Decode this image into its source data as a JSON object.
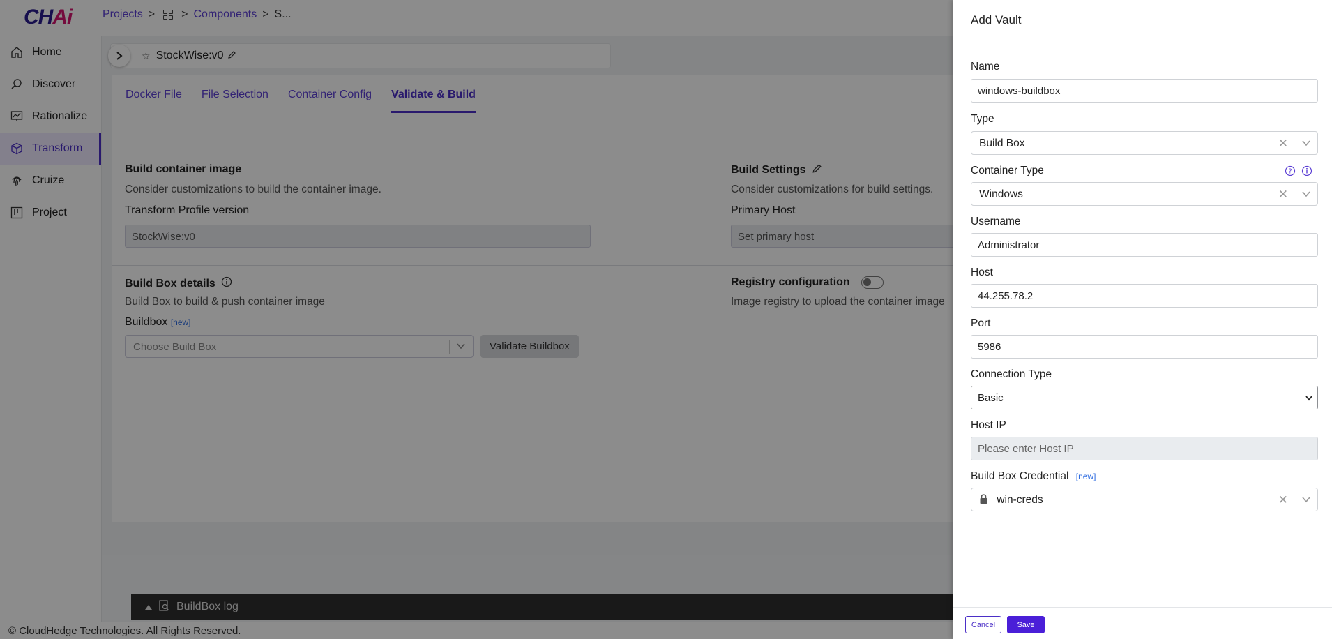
{
  "app": {
    "logo_main": "CH",
    "logo_accent": "Ai",
    "breadcrumb": {
      "projects": "Projects",
      "components": "Components",
      "current": "S..."
    },
    "footer": "© CloudHedge Technologies. All Rights Reserved.",
    "buildbox_log": "BuildBox log"
  },
  "sidebar": {
    "items": [
      {
        "label": "Home",
        "icon": "home-icon"
      },
      {
        "label": "Discover",
        "icon": "search-icon"
      },
      {
        "label": "Rationalize",
        "icon": "chart-icon"
      },
      {
        "label": "Transform",
        "icon": "cube-icon"
      },
      {
        "label": "Cruize",
        "icon": "fingerprint-icon"
      },
      {
        "label": "Project",
        "icon": "board-icon"
      }
    ],
    "active": "Transform"
  },
  "project": {
    "name": "StockWise:v0"
  },
  "tabs": [
    "Docker File",
    "File Selection",
    "Container Config",
    "Validate & Build"
  ],
  "build": {
    "container_title": "Build container image",
    "container_desc": "Consider customizations to build the container image.",
    "profile_label": "Transform Profile version",
    "profile_value": "StockWise:v0",
    "settings_title": "Build Settings",
    "settings_desc": "Consider customizations for build settings.",
    "primary_host_label": "Primary Host",
    "primary_host_placeholder": "Set primary host",
    "buildbox_title": "Build Box details",
    "buildbox_desc": "Build Box to build & push container image",
    "buildbox_label": "Buildbox",
    "new_tag": "[new]",
    "buildbox_placeholder": "Choose Build Box",
    "validate_button": "Validate Buildbox",
    "registry_title": "Registry configuration",
    "registry_desc": "Image registry to upload the container image"
  },
  "drawer": {
    "title": "Add Vault",
    "name_label": "Name",
    "name_value": "windows-buildbox",
    "type_label": "Type",
    "type_value": "Build Box",
    "container_type_label": "Container Type",
    "container_type_value": "Windows",
    "username_label": "Username",
    "username_value": "Administrator",
    "host_label": "Host",
    "host_value": "44.255.78.2",
    "port_label": "Port",
    "port_value": "5986",
    "connection_type_label": "Connection Type",
    "connection_type_value": "Basic",
    "host_ip_label": "Host IP",
    "host_ip_placeholder": "Please enter Host IP",
    "credential_label": "Build Box Credential",
    "credential_new": "[new]",
    "credential_value": "win-creds",
    "cancel": "Cancel",
    "save": "Save"
  },
  "colors": {
    "brand": "#4b2fc7",
    "accent": "#d4146f",
    "save": "#4a1fd8"
  }
}
